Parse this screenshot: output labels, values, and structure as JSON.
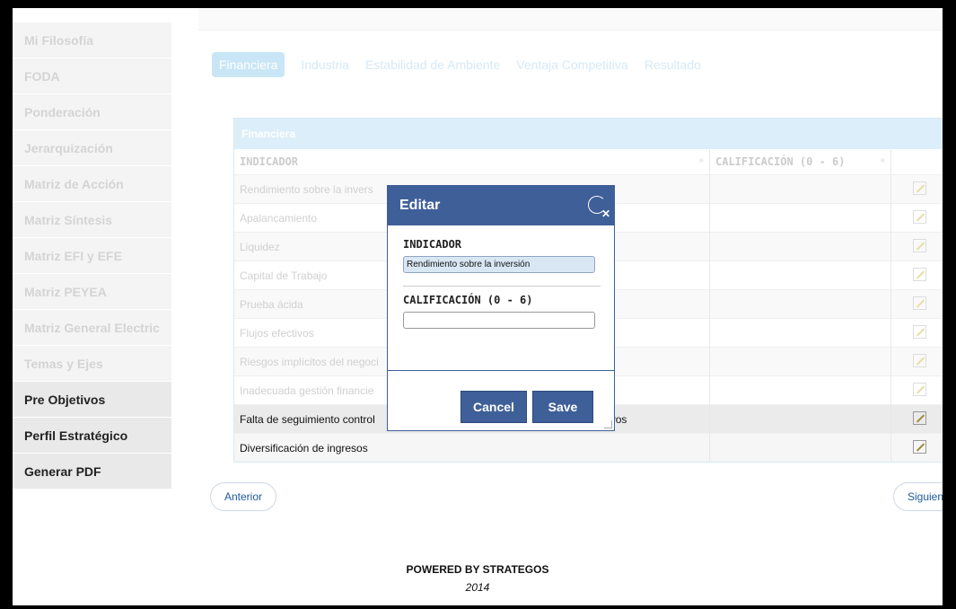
{
  "sidebar": {
    "items": [
      {
        "label": "Mi Filosofía"
      },
      {
        "label": "FODA"
      },
      {
        "label": "Ponderación"
      },
      {
        "label": "Jerarquización"
      },
      {
        "label": "Matriz de Acción"
      },
      {
        "label": "Matriz Síntesis"
      },
      {
        "label": "Matriz EFI y EFE"
      },
      {
        "label": "Matriz PEYEA"
      },
      {
        "label": "Matriz General Electric"
      },
      {
        "label": "Temas y Ejes"
      },
      {
        "label": "Pre Objetivos"
      },
      {
        "label": "Perfil Estratégico"
      },
      {
        "label": "Generar PDF"
      }
    ]
  },
  "tabs": [
    "Financiera",
    "Industria",
    "Estabilidad de Ambiente",
    "Ventaja Competitiva",
    "Resultado"
  ],
  "active_tab": "Financiera",
  "table": {
    "title": "Financiera",
    "headers": [
      "INDICADOR",
      "CALIFICACIÓN (0 - 6)"
    ],
    "rows": [
      {
        "indicador": "Rendimiento sobre la invers",
        "calificacion": ""
      },
      {
        "indicador": "Apalancamiento",
        "calificacion": ""
      },
      {
        "indicador": "Liquidez",
        "calificacion": ""
      },
      {
        "indicador": "Capital de Trabajo",
        "calificacion": ""
      },
      {
        "indicador": "Prueba ácida",
        "calificacion": ""
      },
      {
        "indicador": "Flujos efectivos",
        "calificacion": ""
      },
      {
        "indicador": "Riesgos implícitos del negoci",
        "calificacion": ""
      },
      {
        "indicador": "Inadecuada gestión financie",
        "calificacion": ""
      },
      {
        "indicador": "Falta de seguimiento control",
        "indicador_tail": "vos",
        "calificacion": ""
      },
      {
        "indicador": "Diversificación de ingresos",
        "calificacion": ""
      }
    ]
  },
  "pager": {
    "prev": "Anterior",
    "next": "Siguiente"
  },
  "footer": {
    "powered": "POWERED BY STRATEGOS",
    "year": "2014"
  },
  "dialog": {
    "title": "Editar",
    "indicador_label": "INDICADOR",
    "indicador_value": "Rendimiento sobre la inversión",
    "calificacion_label": "CALIFICACIÓN (0 - 6)",
    "calificacion_value": "",
    "cancel": "Cancel",
    "save": "Save"
  },
  "colors": {
    "dialog_header": "#3f5f99",
    "tab_active": "#c9e6f6",
    "panel_head": "#dceefa"
  },
  "icons": {
    "edit": "pencil-edit-icon",
    "close": "close-icon",
    "sort": "sort-icon"
  }
}
